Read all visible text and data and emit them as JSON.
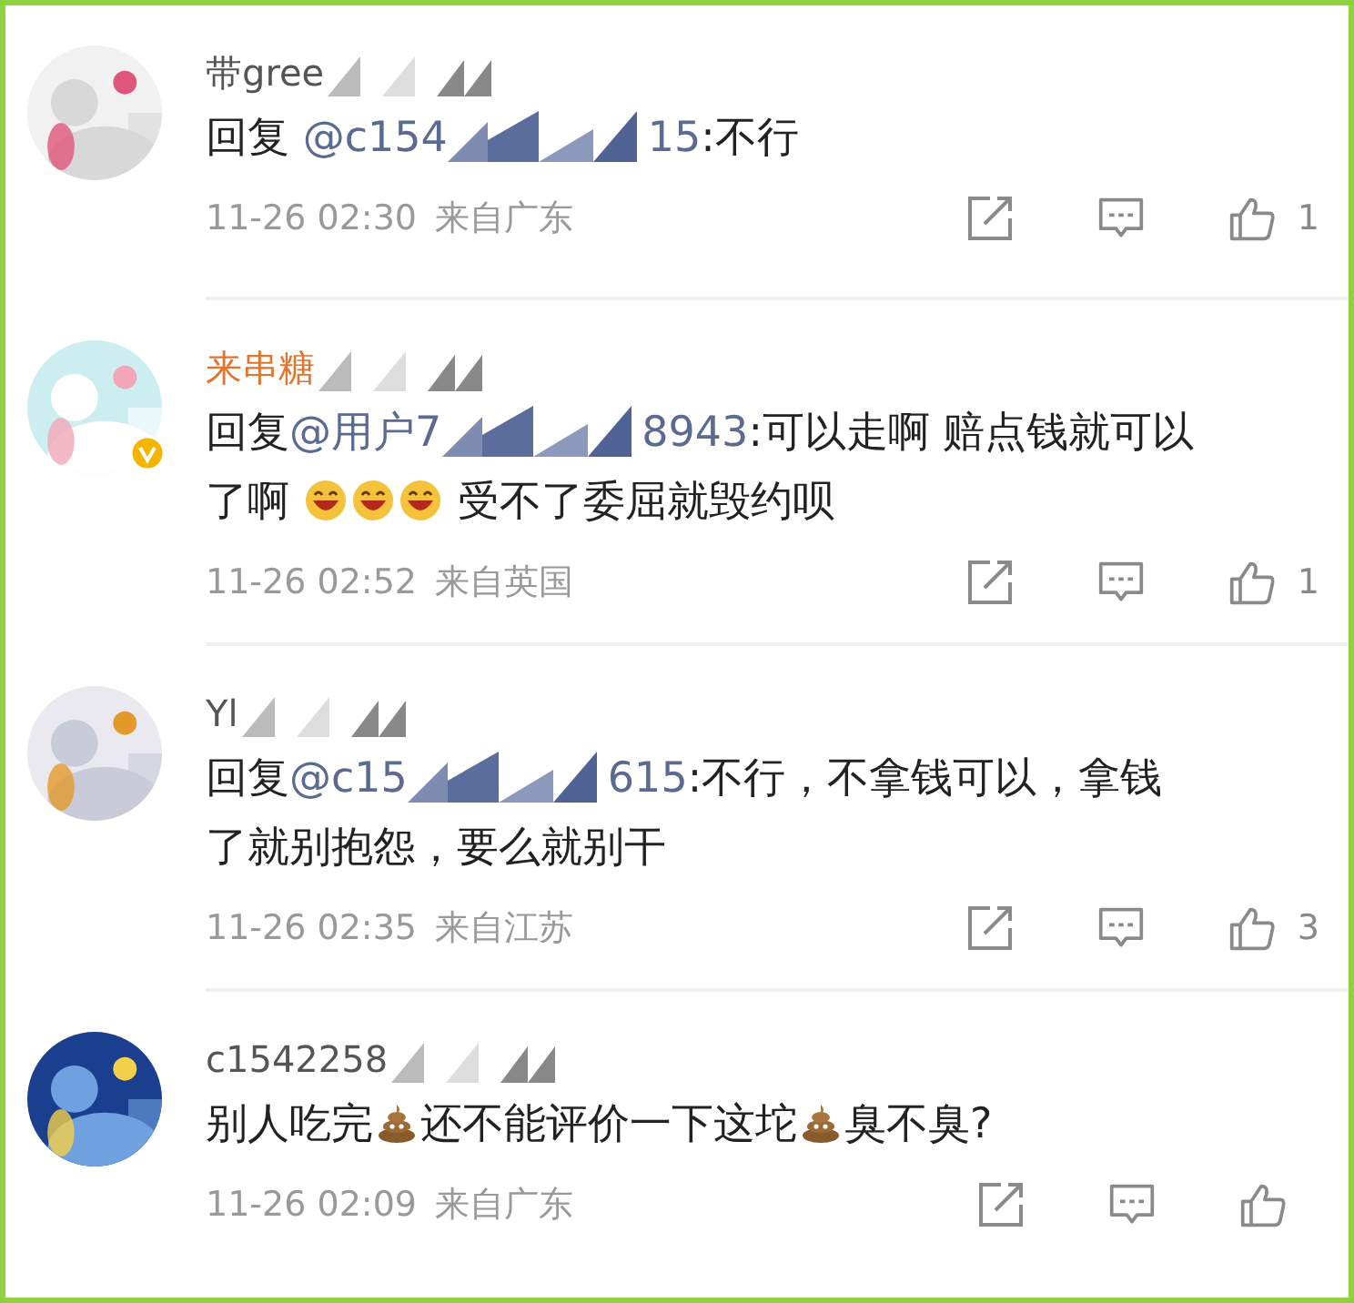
{
  "comments": [
    {
      "avatar": {
        "kind": "picture",
        "verified": false
      },
      "name": "带gree",
      "vip": false,
      "body": [
        {
          "kind": "text",
          "text": "回复 "
        },
        {
          "kind": "mention",
          "text": "@c154"
        },
        {
          "kind": "redacted"
        },
        {
          "kind": "mention",
          "text": "15"
        },
        {
          "kind": "text",
          "text": ":不行"
        }
      ],
      "time": "11-26 02:30",
      "location": "来自广东",
      "likes": "1"
    },
    {
      "avatar": {
        "kind": "picture",
        "verified": true
      },
      "name": "来串糖",
      "vip": true,
      "body": [
        {
          "kind": "text",
          "text": "回复"
        },
        {
          "kind": "mention",
          "text": "@用户7"
        },
        {
          "kind": "redacted"
        },
        {
          "kind": "mention",
          "text": "8943"
        },
        {
          "kind": "text",
          "text": ":可以走啊 赔点钱就可以"
        },
        {
          "kind": "text",
          "text": "了啊 ",
          "line_start": true
        },
        {
          "kind": "laugh"
        },
        {
          "kind": "laugh"
        },
        {
          "kind": "laugh"
        },
        {
          "kind": "text",
          "text": " 受不了委屈就毁约呗"
        }
      ],
      "time": "11-26 02:52",
      "location": "来自英国",
      "likes": "1"
    },
    {
      "avatar": {
        "kind": "picture",
        "verified": false
      },
      "name": "Yl",
      "vip": false,
      "body": [
        {
          "kind": "text",
          "text": "回复"
        },
        {
          "kind": "mention",
          "text": "@c15"
        },
        {
          "kind": "redacted"
        },
        {
          "kind": "mention",
          "text": "615"
        },
        {
          "kind": "text",
          "text": ":不行，不拿钱可以，拿钱"
        },
        {
          "kind": "text",
          "text": "了就别抱怨，要么就别干",
          "line_start": true
        }
      ],
      "time": "11-26 02:35",
      "location": "来自江苏",
      "likes": "3"
    },
    {
      "avatar": {
        "kind": "picture",
        "verified": false
      },
      "name": "c1542258",
      "vip": false,
      "body": [
        {
          "kind": "text",
          "text": "别人吃完"
        },
        {
          "kind": "poop"
        },
        {
          "kind": "text",
          "text": "还不能评价一下这坨"
        },
        {
          "kind": "poop"
        },
        {
          "kind": "text",
          "text": "臭不臭?"
        }
      ],
      "time": "11-26 02:09",
      "location": "来自广东"
    }
  ]
}
